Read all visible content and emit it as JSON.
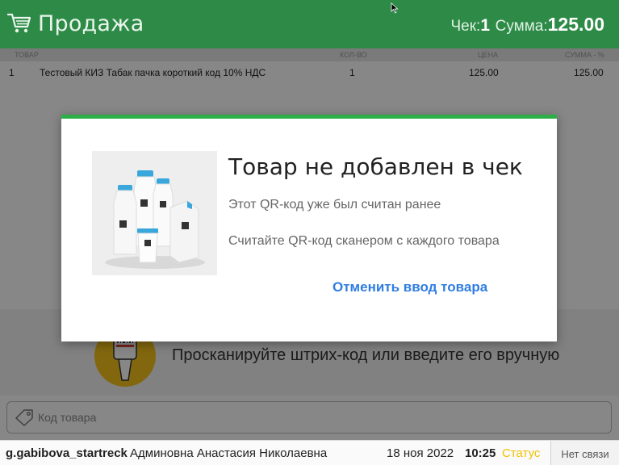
{
  "header": {
    "title": "Продажа",
    "check_label": "Чек:",
    "check_number": "1",
    "sum_label": "Сумма:",
    "sum_value": "125.00",
    "bg_color": "#2e8b47",
    "cart_icon": "shopping-cart-icon"
  },
  "table": {
    "columns": [
      "ТОВАР",
      "КОЛ-ВО",
      "ЦЕНА",
      "СУММА - %"
    ],
    "rows": [
      {
        "index": "1",
        "name": "Тестовый КИЗ Табак пачка короткий код 10% НДС",
        "qty": "1",
        "price": "125.00",
        "sum": "125.00"
      }
    ]
  },
  "scan": {
    "icon": "barcode-scanner-icon",
    "prompt": "Просканируйте штрих-код или введите его вручную",
    "input_placeholder": "Код товара",
    "input_value": "",
    "tag_icon": "tag-icon"
  },
  "statusbar": {
    "login": "g.gabibova_startreck",
    "user_name": "Админовна Анастасия Николаевна",
    "date": "18 ноя 2022",
    "time": "10:25",
    "status_label": "Статус",
    "connection": "Нет связи",
    "status_color": "#f2c200"
  },
  "dialog": {
    "accent_color": "#2eae48",
    "image": "milk-bottles-image",
    "title": "Товар не добавлен в чек",
    "message1": "Этот QR-код уже был считан ранее",
    "message2": "Считайте QR-код сканером с каждого товара",
    "cancel_label": "Отменить ввод товара",
    "cancel_color": "#2f7de1"
  }
}
